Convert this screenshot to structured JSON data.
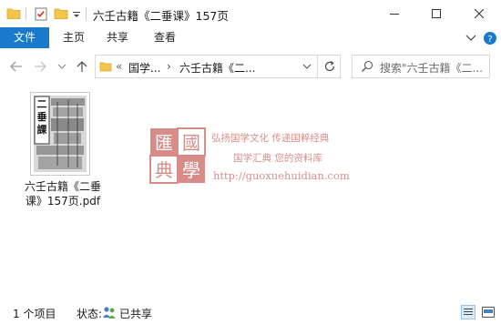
{
  "window": {
    "title": "六壬古籍《二垂课》157页",
    "controls": [
      "minimize-icon",
      "maximize-icon",
      "close-icon"
    ]
  },
  "quick_access": {
    "icons": [
      "folder-icon",
      "properties-icon",
      "new-folder-icon",
      "customize-dropdown-icon"
    ]
  },
  "ribbon": {
    "tabs": [
      {
        "label": "文件",
        "active": true
      },
      {
        "label": "主页"
      },
      {
        "label": "共享"
      },
      {
        "label": "查看"
      }
    ]
  },
  "address": {
    "overflow": "«",
    "segments": [
      "国学...",
      "六壬古籍《二..."
    ],
    "separator": "›"
  },
  "search": {
    "placeholder": "搜索\"六壬古籍《二..."
  },
  "files": [
    {
      "name": "六壬古籍《二垂课》157页.pdf",
      "name_line1": "六壬古籍《二垂",
      "name_line2": "课》157页.pdf",
      "thumb_title": "二垂課"
    }
  ],
  "watermark": {
    "seal_chars": [
      "匯",
      "國",
      "典",
      "學"
    ],
    "line1": "弘扬国学文化  传递国粹经典",
    "line2": "国学汇典  您的资料库",
    "url": "http://guoxuehuidian.com"
  },
  "status": {
    "count": "1 个项目",
    "state_label": "状态:",
    "state_value": "已共享"
  },
  "colors": {
    "file_tab": "#1979ca",
    "folder": "#f3c54b",
    "watermark": "#b73028"
  }
}
